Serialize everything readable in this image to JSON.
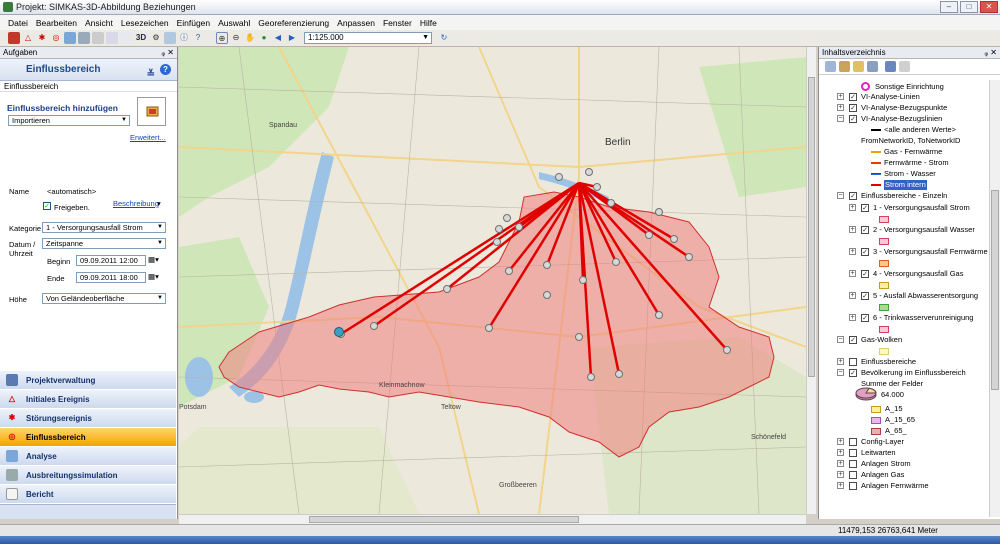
{
  "window": {
    "title": "Projekt: SIMKAS-3D-Abbildung Beziehungen"
  },
  "menu": [
    "Datei",
    "Bearbeiten",
    "Ansicht",
    "Lesezeichen",
    "Einfügen",
    "Auswahl",
    "Georeferenzierung",
    "Anpassen",
    "Fenster",
    "Hilfe"
  ],
  "toolbar": {
    "label_3d": "3D",
    "scale": "1:125.000"
  },
  "tasks": {
    "header": "Aufgaben",
    "title": "Einflussbereich",
    "subheader": "Einflussbereich",
    "section": "Einflussbereich hinzufügen",
    "import_select": "Importieren",
    "advanced_link": "Erweitert...",
    "name_label": "Name",
    "name_value": "<automatisch>",
    "release_label": "Freigeben.",
    "description_link": "Beschreibung",
    "category_label": "Kategorie",
    "category_value": "1 - Versorgungsausfall Strom",
    "date_label": "Datum /",
    "time_label": "Uhrzeit",
    "date_mode": "Zeitspanne",
    "begin_label": "Beginn",
    "begin_value": "09.09.2011 12:00",
    "end_label": "Ende",
    "end_value": "09.09.2011 18:00",
    "height_label": "Höhe",
    "height_value": "Von Geländeoberfläche"
  },
  "nav": [
    {
      "label": "Projektverwaltung",
      "icon": "list-icon",
      "active": false
    },
    {
      "label": "Initiales Ereignis",
      "icon": "warning-triangle-icon",
      "active": false
    },
    {
      "label": "Störungsereignis",
      "icon": "alert-icon",
      "active": false
    },
    {
      "label": "Einflussbereich",
      "icon": "target-icon",
      "active": true
    },
    {
      "label": "Analyse",
      "icon": "chart-icon",
      "active": false
    },
    {
      "label": "Ausbreitungssimulation",
      "icon": "cloud-icon",
      "active": false
    },
    {
      "label": "Bericht",
      "icon": "document-icon",
      "active": false
    }
  ],
  "map": {
    "labels": [
      "Berlin",
      "Kleinmachnow",
      "Potsdam",
      "Teltow",
      "Großbeeren",
      "Schönefeld",
      "Spandau"
    ]
  },
  "toc": {
    "header": "Inhaltsverzeichnis",
    "items": [
      {
        "text": "Sonstige Einrichtung",
        "level": 3,
        "expander": "",
        "checkbox": false,
        "swatch": "ring"
      },
      {
        "text": "VI-Analyse-Linien",
        "level": 1,
        "expander": "+",
        "checkbox": true,
        "swatch": ""
      },
      {
        "text": "VI-Analyse-Bezugspunkte",
        "level": 1,
        "expander": "+",
        "checkbox": true,
        "swatch": ""
      },
      {
        "text": "VI-Analyse-Bezugslinien",
        "level": 1,
        "expander": "-",
        "checkbox": true,
        "swatch": ""
      },
      {
        "text": "<alle anderen Werte>",
        "level": 2,
        "expander": "",
        "checkbox": false,
        "swatch": "black-line"
      },
      {
        "text": "FromNetworkID, ToNetworkID",
        "level": 2,
        "expander": "",
        "checkbox": false,
        "swatch": ""
      },
      {
        "text": "Gas - Fernwärme",
        "level": 2,
        "expander": "",
        "checkbox": false,
        "swatch": "orange-line"
      },
      {
        "text": "Fernwärme - Strom",
        "level": 2,
        "expander": "",
        "checkbox": false,
        "swatch": "red-orange-line"
      },
      {
        "text": "Strom - Wasser",
        "level": 2,
        "expander": "",
        "checkbox": false,
        "swatch": "blue-red-line"
      },
      {
        "text": "Strom intern",
        "level": 2,
        "expander": "",
        "checkbox": false,
        "swatch": "red-line"
      },
      {
        "text": "Einflussbereiche - Einzeln",
        "level": 1,
        "expander": "-",
        "checkbox": true,
        "swatch": ""
      },
      {
        "text": "1 - Versorgungsausfall Strom",
        "level": 2,
        "expander": "+",
        "checkbox": true,
        "swatch": ""
      },
      {
        "text": "",
        "level": 3,
        "expander": "",
        "checkbox": false,
        "swatch": "box-pink"
      },
      {
        "text": "2 - Versorgungsausfall Wasser",
        "level": 2,
        "expander": "+",
        "checkbox": true,
        "swatch": ""
      },
      {
        "text": "",
        "level": 3,
        "expander": "",
        "checkbox": false,
        "swatch": "box-pink"
      },
      {
        "text": "3 - Versorgungsausfall Fernwärme",
        "level": 2,
        "expander": "+",
        "checkbox": true,
        "swatch": ""
      },
      {
        "text": "",
        "level": 3,
        "expander": "",
        "checkbox": false,
        "swatch": "box-orange"
      },
      {
        "text": "4 - Versorgungsausfall Gas",
        "level": 2,
        "expander": "+",
        "checkbox": true,
        "swatch": ""
      },
      {
        "text": "",
        "level": 3,
        "expander": "",
        "checkbox": false,
        "swatch": "box-yellow"
      },
      {
        "text": "5 - Ausfall Abwasserentsorgung",
        "level": 2,
        "expander": "+",
        "checkbox": true,
        "swatch": ""
      },
      {
        "text": "",
        "level": 3,
        "expander": "",
        "checkbox": false,
        "swatch": "box-green"
      },
      {
        "text": "6 - Trinkwasserverunreinigung",
        "level": 2,
        "expander": "+",
        "checkbox": true,
        "swatch": ""
      },
      {
        "text": "",
        "level": 3,
        "expander": "",
        "checkbox": false,
        "swatch": "box-pink"
      },
      {
        "text": "Gas-Wolken",
        "level": 1,
        "expander": "-",
        "checkbox": true,
        "swatch": ""
      },
      {
        "text": "",
        "level": 3,
        "expander": "",
        "checkbox": false,
        "swatch": "box-lightyellow"
      },
      {
        "text": "Einflussbereiche",
        "level": 1,
        "expander": "+",
        "checkbox": false,
        "swatch": ""
      },
      {
        "text": "Bevölkerung im Einflussbereich",
        "level": 1,
        "expander": "-",
        "checkbox": true,
        "swatch": ""
      },
      {
        "text": "Summe der Felder",
        "level": 2,
        "expander": "",
        "checkbox": false,
        "swatch": ""
      },
      {
        "text": "64.000",
        "level": 3,
        "expander": "",
        "checkbox": false,
        "swatch": "pie"
      },
      {
        "text": "A_15",
        "level": 3,
        "expander": "",
        "checkbox": false,
        "swatch": "box-yellow"
      },
      {
        "text": "A_15_65",
        "level": 3,
        "expander": "",
        "checkbox": false,
        "swatch": "box-violet"
      },
      {
        "text": "A_65_",
        "level": 3,
        "expander": "",
        "checkbox": false,
        "swatch": "box-rose"
      },
      {
        "text": "Config-Layer",
        "level": 1,
        "expander": "+",
        "checkbox": false,
        "swatch": ""
      },
      {
        "text": "Leitwarten",
        "level": 1,
        "expander": "+",
        "checkbox": false,
        "swatch": ""
      },
      {
        "text": "Anlagen Strom",
        "level": 1,
        "expander": "+",
        "checkbox": false,
        "swatch": ""
      },
      {
        "text": "Anlagen Gas",
        "level": 1,
        "expander": "+",
        "checkbox": false,
        "swatch": ""
      },
      {
        "text": "Anlagen Fernwärme",
        "level": 1,
        "expander": "+",
        "checkbox": false,
        "swatch": ""
      }
    ]
  },
  "status": {
    "coords": "11479,153  26763,641 Meter"
  },
  "colors": {
    "accent": "#f5a300",
    "region": "#f08080",
    "lines": "#e00000"
  }
}
